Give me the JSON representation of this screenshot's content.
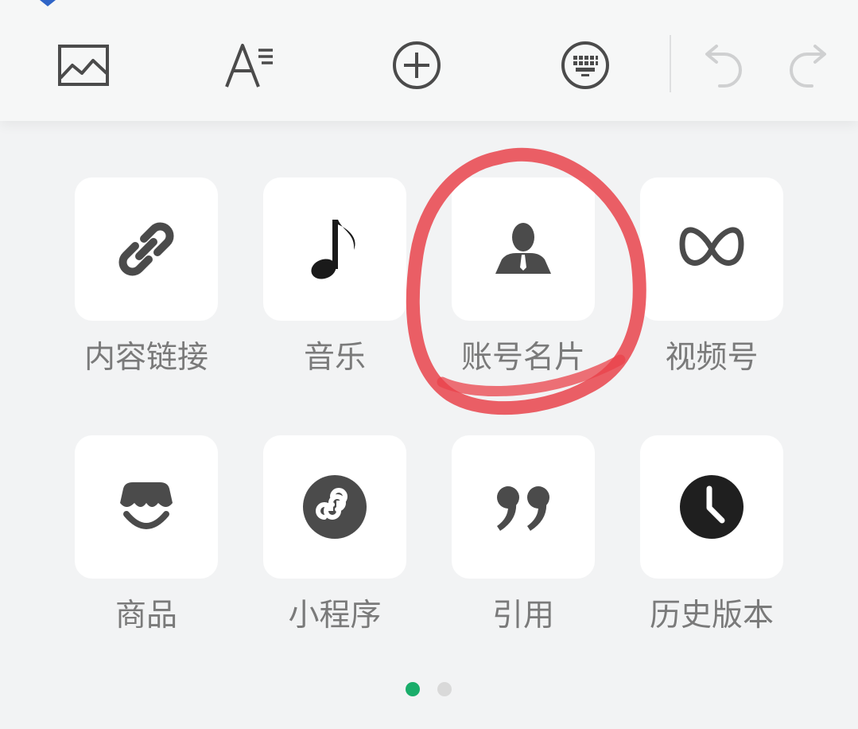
{
  "toolbar": {
    "tools": [
      {
        "icon": "image-icon"
      },
      {
        "icon": "text-format-icon"
      },
      {
        "icon": "add-circle-icon"
      },
      {
        "icon": "keyboard-icon"
      },
      {
        "icon": "undo-icon"
      },
      {
        "icon": "redo-icon"
      }
    ]
  },
  "panel": {
    "items": [
      {
        "label": "内容链接",
        "icon": "link-icon"
      },
      {
        "label": "音乐",
        "icon": "music-note-icon"
      },
      {
        "label": "账号名片",
        "icon": "account-card-icon"
      },
      {
        "label": "视频号",
        "icon": "channels-icon"
      },
      {
        "label": "商品",
        "icon": "shop-icon"
      },
      {
        "label": "小程序",
        "icon": "mini-program-icon"
      },
      {
        "label": "引用",
        "icon": "quote-icon"
      },
      {
        "label": "历史版本",
        "icon": "history-clock-icon"
      }
    ]
  },
  "pagination": {
    "pages": 2,
    "current": 1
  },
  "colors": {
    "icon": "#4b4b4b",
    "label": "#7a7a7a",
    "annotation": "#e9434b",
    "active_dot": "#1aad6a"
  }
}
